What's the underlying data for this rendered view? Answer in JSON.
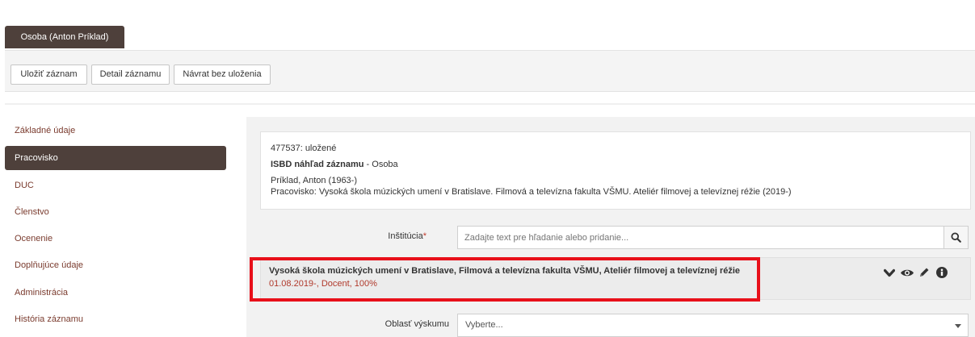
{
  "header": {
    "person_tab": "Osoba (Anton Príklad)"
  },
  "toolbar": {
    "save": "Uložiť záznam",
    "detail": "Detail záznamu",
    "back": "Návrat bez uloženia"
  },
  "sidebar": {
    "items": [
      {
        "label": "Základné údaje"
      },
      {
        "label": "Pracovisko"
      },
      {
        "label": "DUC"
      },
      {
        "label": "Členstvo"
      },
      {
        "label": "Ocenenie"
      },
      {
        "label": "Doplňujúce údaje"
      },
      {
        "label": "Administrácia"
      },
      {
        "label": "História záznamu"
      }
    ]
  },
  "preview": {
    "status": "477537: uložené",
    "isbd_bold": "ISBD náhľad záznamu",
    "isbd_rest": " - Osoba",
    "name": "Príklad, Anton (1963-)",
    "workplace": "Pracovisko: Vysoká škola múzických umení v Bratislave. Filmová a televízna fakulta VŠMU. Ateliér filmovej a televíznej réžie (2019-)"
  },
  "institution": {
    "label": "Inštitúcia",
    "required_mark": "*",
    "placeholder": "Zadajte text pre hľadanie alebo pridanie..."
  },
  "record": {
    "title": "Vysoká škola múzických umení v Bratislave, Filmová a televízna fakulta VŠMU, Ateliér filmovej a televíznej réžie",
    "subtitle": "01.08.2019-, Docent, 100%"
  },
  "research_area": {
    "label": "Oblasť výskumu",
    "value": "Vyberte..."
  },
  "colors": {
    "dark_brown": "#4e403b",
    "link_brown": "#7a3b2e",
    "highlight_red": "#e8101a",
    "sub_red": "#b0392b"
  },
  "icons": [
    "search-icon",
    "chevron-down-icon",
    "eye-icon",
    "pencil-icon",
    "info-icon",
    "caret-down-icon"
  ]
}
